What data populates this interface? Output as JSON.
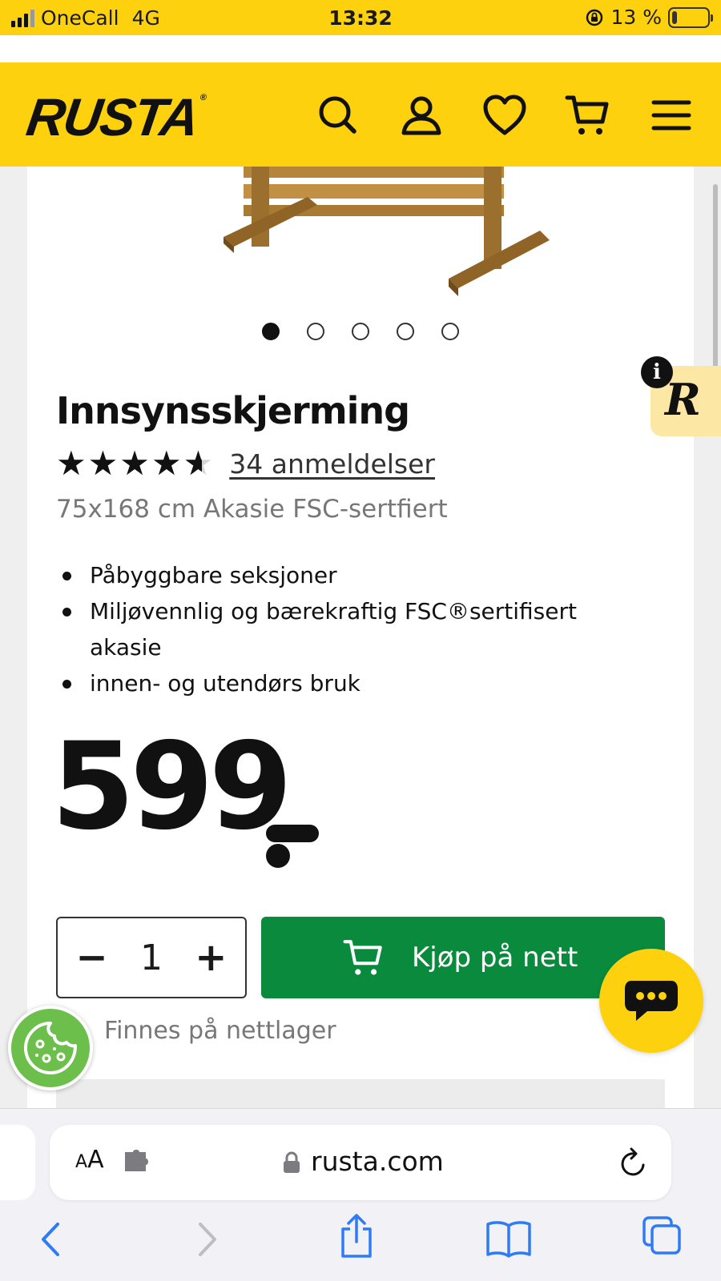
{
  "status_bar": {
    "carrier": "OneCall",
    "network": "4G",
    "time": "13:32",
    "battery": "13 %",
    "battery_level": 0.13
  },
  "header": {
    "logo": "RUSTA",
    "logo_mark": "®",
    "icons": [
      "search-icon",
      "account-icon",
      "heart-icon",
      "cart-icon",
      "menu-icon"
    ]
  },
  "gallery": {
    "image_count": 5,
    "active_index": 0
  },
  "product": {
    "title": "Innsynsskjerming",
    "rating": 4.6,
    "rating_max": 5,
    "stars_glyphs": "★★★★★",
    "reviews_label": "34 anmeldelser",
    "subtitle": "75x168 cm Akasie FSC-sertfiert",
    "features": [
      "Påbyggbare seksjoner",
      "Miljøvennlig og bærekraftig FSC®sertifisert akasie",
      "innen- og utendørs bruk"
    ],
    "price": "599"
  },
  "purchase": {
    "minus": "−",
    "quantity": "1",
    "plus": "+",
    "buy_label": "Kjøp på nett",
    "availability": "Finnes på nettlager"
  },
  "rewards": {
    "letter": "R",
    "info": "i"
  },
  "browser": {
    "aa_small": "A",
    "aa_large": "A",
    "url": "rusta.com"
  },
  "colors": {
    "brand_yellow": "#fdd10e",
    "buy_green": "#0a8a3c",
    "cookie_green": "#6cbf4b",
    "safari_blue": "#2f7bf5"
  }
}
